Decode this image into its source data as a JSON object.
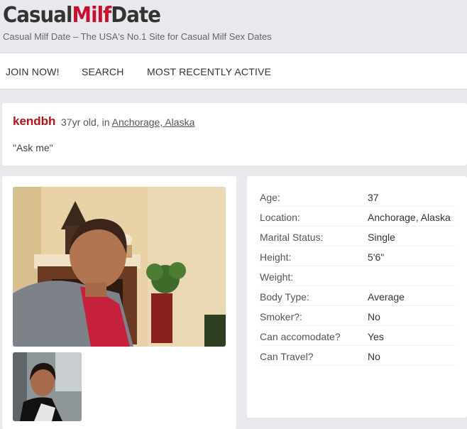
{
  "header": {
    "logo_part1": "Casual",
    "logo_part2": "Milf",
    "logo_part3": "Date",
    "tagline": "Casual Milf Date – The USA's No.1 Site for Casual Milf Sex Dates",
    "accent_color": "#c8102e"
  },
  "nav": {
    "items": [
      {
        "label": "JOIN NOW!"
      },
      {
        "label": "SEARCH"
      },
      {
        "label": "MOST RECENTLY ACTIVE"
      }
    ]
  },
  "profile": {
    "username": "kendbh",
    "age_text": "37yr old, in",
    "location_link": "Anchorage, Alaska",
    "quote": "\"Ask me\""
  },
  "details": {
    "rows": [
      {
        "label": "Age:",
        "value": "37"
      },
      {
        "label": "Location:",
        "value": "Anchorage, Alaska"
      },
      {
        "label": "Marital Status:",
        "value": "Single"
      },
      {
        "label": "Height:",
        "value": "5'6\""
      },
      {
        "label": "Weight:",
        "value": ""
      },
      {
        "label": "Body Type:",
        "value": "Average"
      },
      {
        "label": "Smoker?:",
        "value": "No"
      },
      {
        "label": "Can accomodate?",
        "value": "Yes"
      },
      {
        "label": "Can Travel?",
        "value": "No"
      }
    ]
  }
}
